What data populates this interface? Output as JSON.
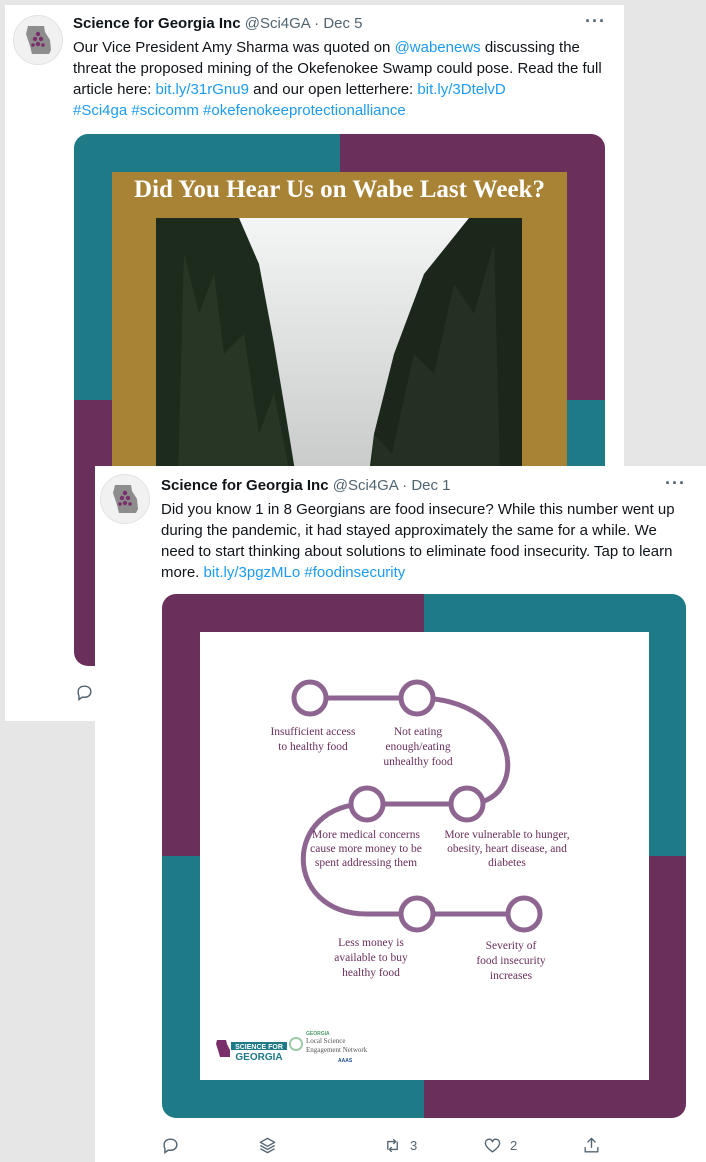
{
  "tweet1": {
    "author_name": "Science for Georgia Inc",
    "handle": "@Sci4GA",
    "separator": "·",
    "date": "Dec 5",
    "more": "···",
    "text_1": "Our Vice President Amy Sharma was quoted on ",
    "mention": "@wabenews",
    "text_2": " discussing the threat the proposed mining of the Okefenokee Swamp could pose. Read the full article here: ",
    "link_1": "bit.ly/31rGnu9",
    "text_3": " and our open letterhere: ",
    "link_2": "bit.ly/3DtelvD",
    "hashtags": "#Sci4ga #scicomm #okefenokeeprotectionalliance",
    "image_title": "Did You Hear Us on Wabe Last Week?",
    "colors": {
      "teal": "#1e7a86",
      "purple": "#6b2f5c",
      "gold": "#a88336"
    }
  },
  "tweet2": {
    "author_name": "Science for Georgia Inc",
    "handle": "@Sci4GA",
    "separator": "·",
    "date": "Dec 1",
    "more": "···",
    "text_1": "Did you know 1 in 8 Georgians are food insecure?  While this number went up during the pandemic, it had stayed approximately the same for a while. We need to start thinking about solutions to eliminate food insecurity. Tap to learn more. ",
    "link_1": "bit.ly/3pgzMLo",
    "hashtag": "#foodinsecurity",
    "diagram": {
      "steps": [
        [
          "Insufficient access",
          "to healthy food"
        ],
        [
          "Not eating",
          "enough/eating",
          "unhealthy food"
        ],
        [
          "More vulnerable to hunger,",
          "obesity, heart disease, and",
          "diabetes"
        ],
        [
          "More medical concerns",
          "cause more money to be",
          "spent addressing them"
        ],
        [
          "Less money is",
          "available to buy",
          "healthy food"
        ],
        [
          "Severity of",
          "food insecurity",
          "increases"
        ]
      ],
      "logo_1": [
        "SCIENCE FOR",
        "GEORGIA"
      ],
      "logo_2": [
        "Local Science",
        "Engagement Network",
        "AAAS"
      ],
      "logo_2_tag": "GEORGIA"
    },
    "actions": {
      "retweets": "3",
      "likes": "2"
    },
    "colors": {
      "teal": "#1e7a86",
      "purple": "#6b2f5c",
      "line": "#8e6491"
    }
  }
}
